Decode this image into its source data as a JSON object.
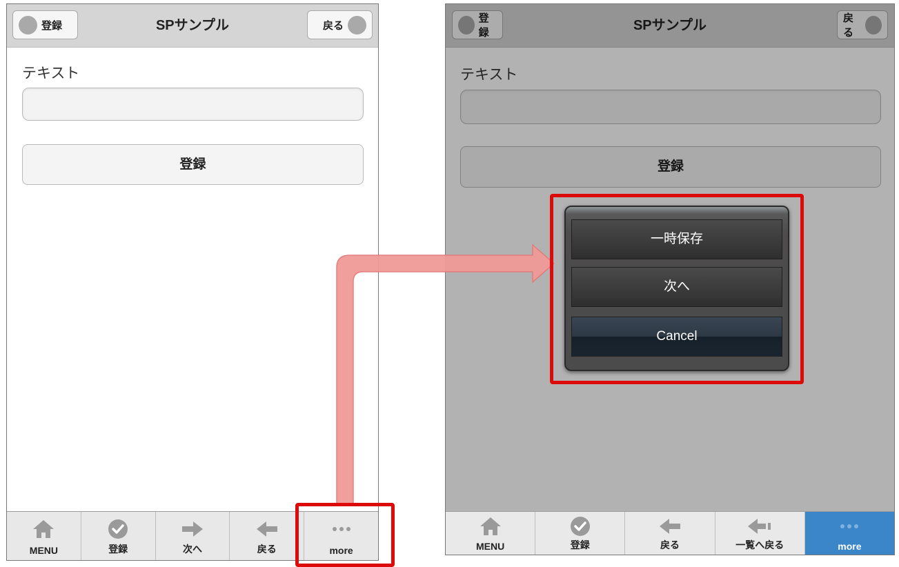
{
  "header": {
    "title": "SPサンプル",
    "left_button": "登録",
    "right_button": "戻る"
  },
  "form": {
    "text_label": "テキスト",
    "text_value": "",
    "submit_label": "登録"
  },
  "left_footer": [
    {
      "label": "MENU",
      "icon": "home-icon"
    },
    {
      "label": "登録",
      "icon": "check-circle-icon"
    },
    {
      "label": "次へ",
      "icon": "arrow-right-icon"
    },
    {
      "label": "戻る",
      "icon": "arrow-left-icon"
    },
    {
      "label": "more",
      "icon": "more-dots-icon"
    }
  ],
  "right_footer": [
    {
      "label": "MENU",
      "icon": "home-icon"
    },
    {
      "label": "登録",
      "icon": "check-circle-icon"
    },
    {
      "label": "戻る",
      "icon": "arrow-left-icon"
    },
    {
      "label": "一覧へ戻る",
      "icon": "arrow-left-list-icon"
    },
    {
      "label": "more",
      "icon": "more-dots-icon",
      "active": true
    }
  ],
  "action_sheet": {
    "items": [
      "一時保存",
      "次へ"
    ],
    "cancel": "Cancel"
  },
  "colors": {
    "highlight_red": "#dd0a0a",
    "arrow_fill": "#f19a98",
    "active_tab": "#3a86c9"
  }
}
